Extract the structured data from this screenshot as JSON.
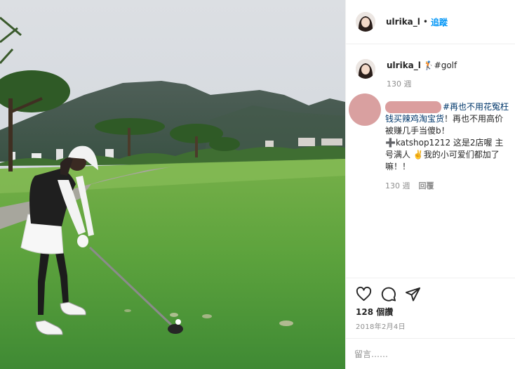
{
  "header": {
    "username": "ulrika_l",
    "separator": "•",
    "follow_label": "追蹤"
  },
  "caption": {
    "username": "ulrika_l",
    "text": "🏌#golf",
    "tag": "#golf",
    "time": "130 週"
  },
  "comment": {
    "text_tag": "#再也不用花冤枉钱买辣鸡淘宝货",
    "text_rest": "！再也不用高价被赚几手当傻b！➕katshop1212 这是2店喔 主号满人 ✌️我的小可爱们都加了嘛！！",
    "time": "130 週",
    "reply_label": "回覆"
  },
  "actions": {
    "like_icon": "heart-icon",
    "comment_icon": "comment-icon",
    "share_icon": "share-icon"
  },
  "stats": {
    "likes": "128 個讚",
    "date": "2018年2月4日"
  },
  "composer": {
    "placeholder": "留言……"
  },
  "colors": {
    "link": "#0095f6",
    "hashtag": "#00376b",
    "muted": "#8e8e8e",
    "border": "#efefef",
    "redaction": "#db9e9e"
  }
}
